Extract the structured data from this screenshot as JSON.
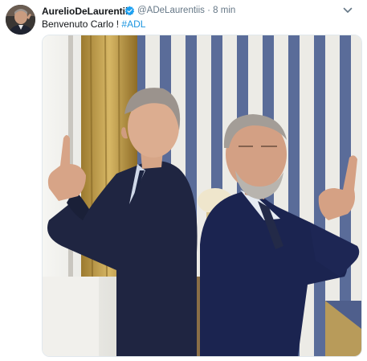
{
  "tweet": {
    "author_name": "AurelioDeLaurentiis",
    "author_handle": "@ADeLaurentiis",
    "separator": "·",
    "time": "8 min",
    "text_prefix": "Benvenuto Carlo ! ",
    "hashtag": "#ADL",
    "verified_icon": "verified-badge-icon",
    "menu_icon": "chevron-down-icon"
  },
  "colors": {
    "name": "#14171a",
    "handle": "#657786",
    "link": "#1b95e0",
    "verified": "#1da1f2",
    "stripe_blue": "#5a6c99",
    "stripe_white": "#ecebe6"
  }
}
